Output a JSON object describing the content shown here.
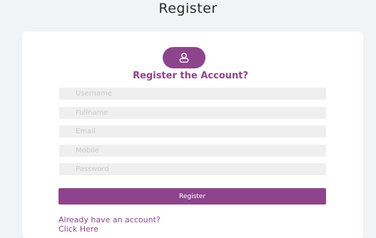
{
  "page": {
    "title": "Register"
  },
  "form": {
    "heading": "Register the Account?",
    "fields": [
      {
        "placeholder": "Username",
        "value": ""
      },
      {
        "placeholder": "Fullname",
        "value": ""
      },
      {
        "placeholder": "Email",
        "value": ""
      },
      {
        "placeholder": "Mobile",
        "value": ""
      },
      {
        "placeholder": "Password",
        "value": ""
      }
    ],
    "submit_label": "Register",
    "login_link": "Already have an account? Click Here"
  },
  "icons": {
    "avatar": "user-icon"
  },
  "colors": {
    "accent": "#8e448c",
    "field_background": "#efefef",
    "page_background": "#f2f3f5"
  }
}
